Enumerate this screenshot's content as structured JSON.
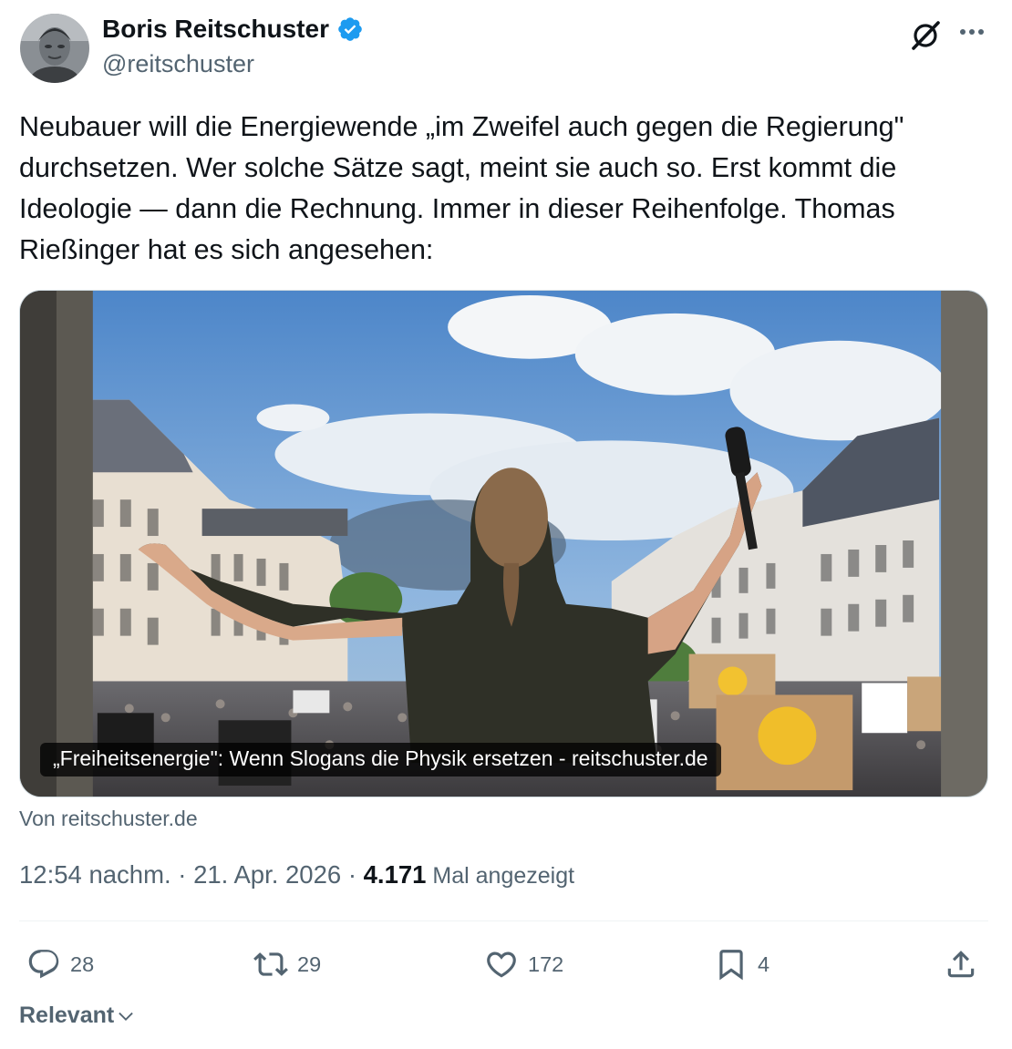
{
  "author": {
    "name": "Boris Reitschuster",
    "handle": "@reitschuster",
    "avatar_icon": "user-avatar",
    "verified_color": "#1d9bf0"
  },
  "tweet": {
    "text": "Neubauer will die Energiewende „im Zweifel auch gegen die Regierung\"\ndurchsetzen. Wer solche Sätze sagt, meint sie auch so. Erst kommt die\nIdeologie — dann die Rechnung. Immer in dieser Reihenfolge. Thomas\nRießinger hat es sich angesehen:"
  },
  "card": {
    "caption": "„Freiheitsenergie\": Wenn Slogans die Physik ersetzen - reitschuster.de",
    "source": "Von reitschuster.de"
  },
  "meta": {
    "time": "12:54 nachm.",
    "sep1": " · ",
    "date": "21. Apr. 2026",
    "sep2": " · ",
    "views_count": "4.171",
    "views_label": " Mal angezeigt"
  },
  "actions": {
    "replies": "28",
    "reposts": "29",
    "likes": "172",
    "bookmarks": "4"
  },
  "sort": {
    "label": "Relevant"
  },
  "icons": [
    "verified-badge-icon",
    "grok-icon",
    "more-icon",
    "reply-icon",
    "repost-icon",
    "like-icon",
    "bookmark-icon",
    "share-icon",
    "chevron-down-icon"
  ],
  "colors": {
    "text": "#0f1419",
    "secondary": "#536471",
    "accent": "#1d9bf0"
  }
}
